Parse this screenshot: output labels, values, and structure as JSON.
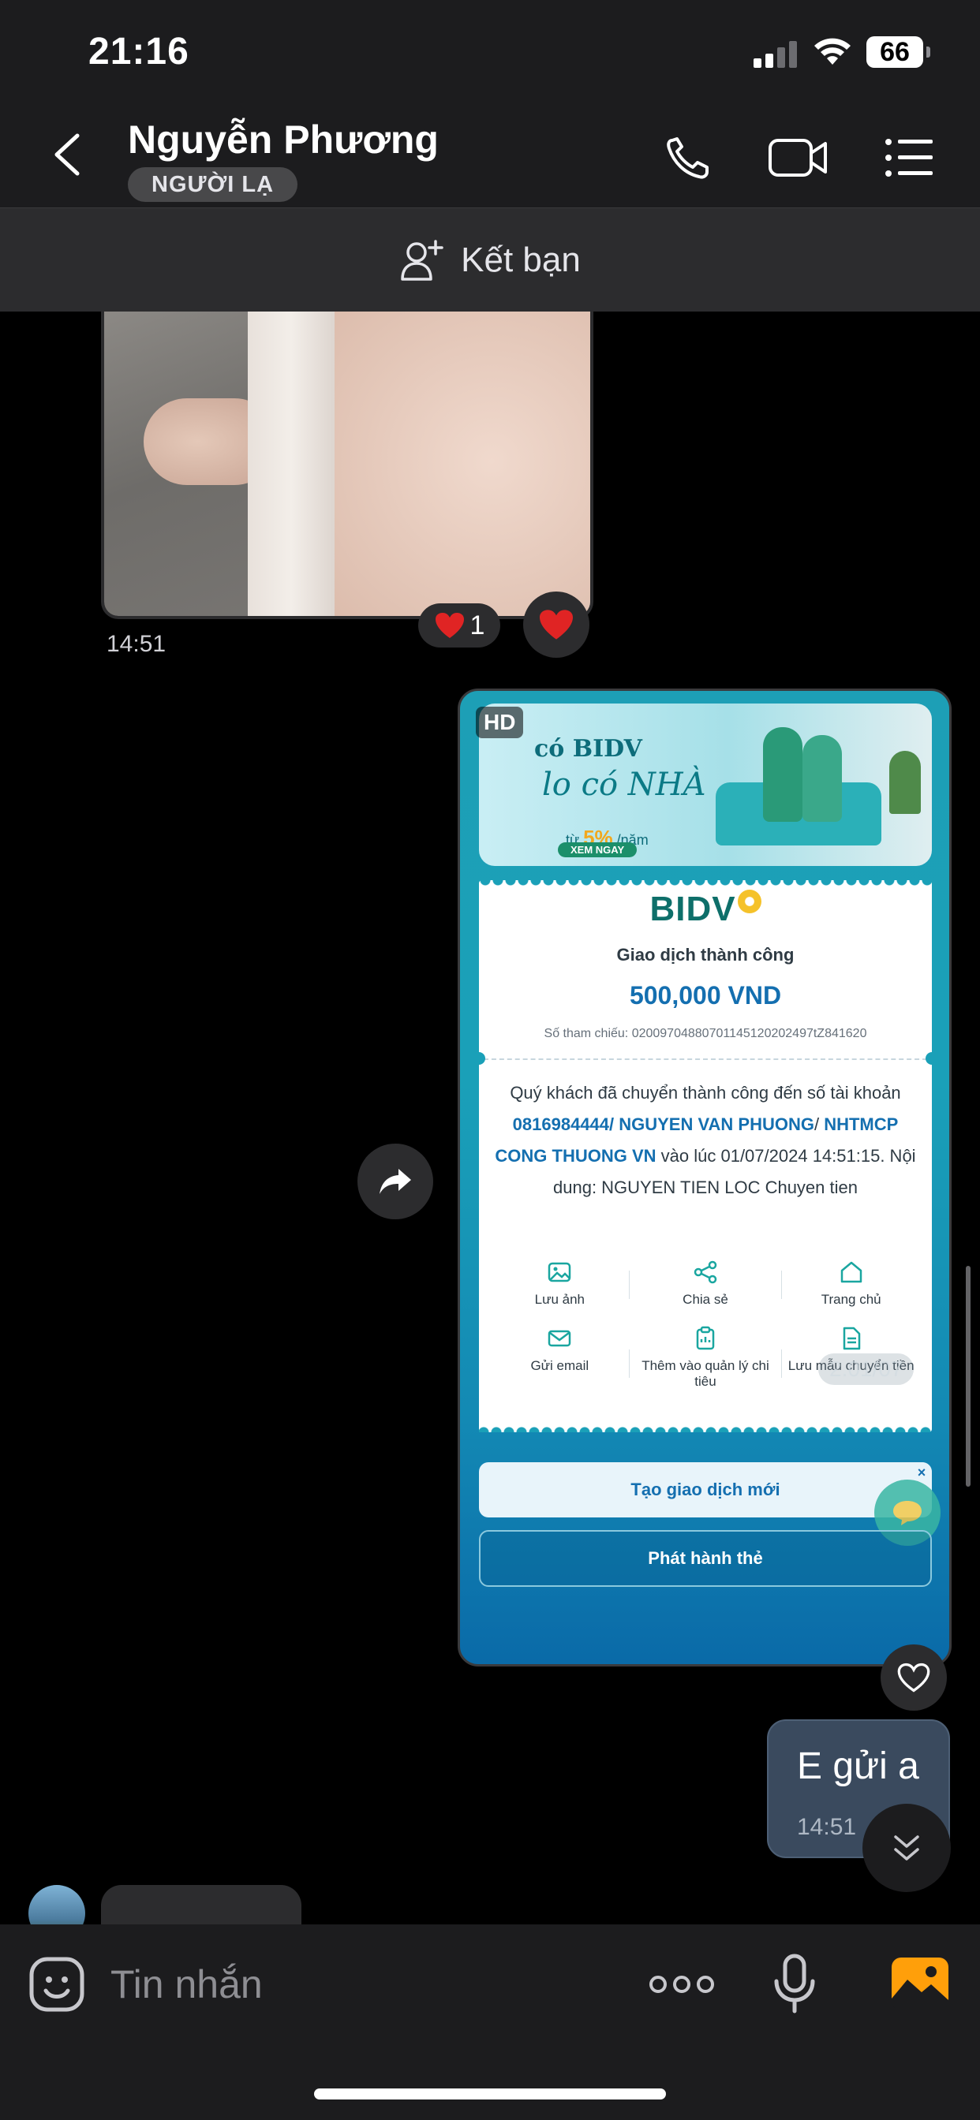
{
  "status_bar": {
    "time": "21:16",
    "battery": "66"
  },
  "header": {
    "contact_name": "Nguyễn Phương",
    "badge": "NGƯỜI LẠ"
  },
  "friend_bar": {
    "label": "Kết bạn"
  },
  "messages": {
    "photo": {
      "time": "14:51",
      "reaction_count": "1"
    },
    "receipt": {
      "hd_label": "HD",
      "banner": {
        "line1": "có BIDV",
        "line2": "lo có NHÀ",
        "rate_prefix": "từ",
        "rate": "5%",
        "rate_suffix": "/năm",
        "cta": "XEM NGAY"
      },
      "bank_logo": "BIDV",
      "title": "Giao dịch thành công",
      "amount": "500,000 VND",
      "reference": "Số tham chiếu: 020097048807011451202024​97tZ841620",
      "desc_1": "Quý khách đã chuyển thành công đến số tài khoản ",
      "account": "0816984444/ NGUYEN VAN PHUONG",
      "desc_2": "/ ",
      "bank_name": "NHTMCP CONG THUONG VN",
      "desc_3": " vào lúc 01/07/2024 14:51:15. Nội dung: NGUYEN TIEN LOC Chuyen tien",
      "actions": [
        {
          "label": "Lưu ảnh"
        },
        {
          "label": "Chia sẻ"
        },
        {
          "label": "Trang chủ"
        },
        {
          "label": "Gửi email"
        },
        {
          "label": "Thêm vào quản lý chi tiêu"
        },
        {
          "label": "Lưu mẫu chuyển tiền"
        }
      ],
      "ghost_timestamp": "2.01/07",
      "new_tx_button": "Tạo giao dịch mới",
      "issue_card_button": "Phát hành thẻ"
    },
    "text": {
      "body": "E gửi a",
      "time": "14:51"
    }
  },
  "input": {
    "placeholder": "Tin nhắn"
  },
  "colors": {
    "accent_blue": "#146fb0",
    "bidv_teal": "#0e6f6a",
    "bubble_self": "#3a4a5e"
  }
}
